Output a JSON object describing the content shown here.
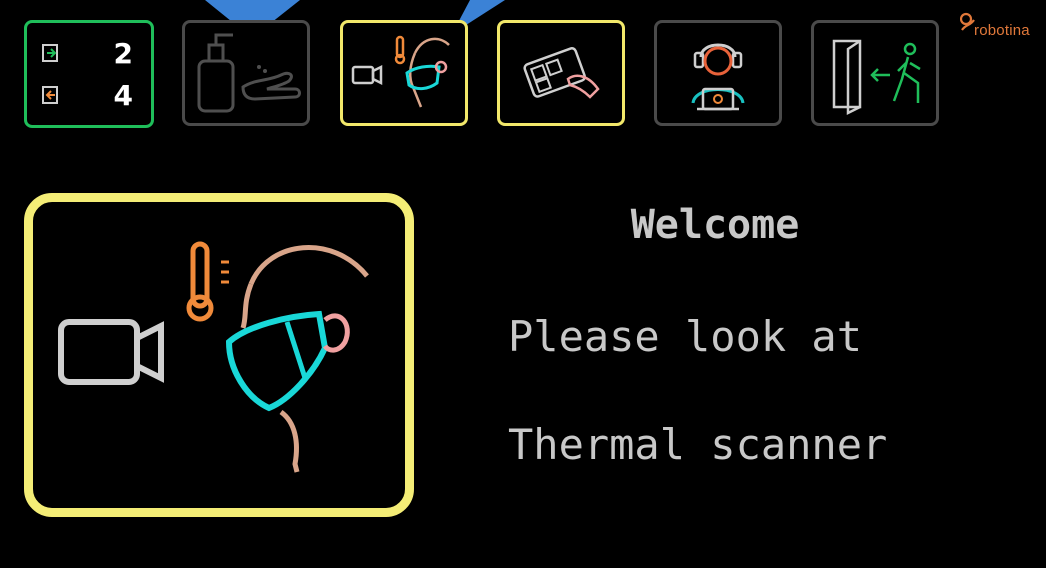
{
  "brand": {
    "name": "robotina"
  },
  "counters": {
    "entered": "2",
    "exited": "4"
  },
  "steps": [
    {
      "icon": "entry-exit-counter-icon",
      "active": false
    },
    {
      "icon": "hand-sanitizer-icon",
      "active": false
    },
    {
      "icon": "thermal-scan-icon",
      "active": true
    },
    {
      "icon": "qr-card-icon",
      "active": true
    },
    {
      "icon": "operator-headset-icon",
      "active": false
    },
    {
      "icon": "exit-door-icon",
      "active": false
    }
  ],
  "message": {
    "title": "Welcome",
    "line1": "Please look at",
    "line2": "Thermal scanner"
  },
  "colors": {
    "background": "#000000",
    "active_border": "#f2e86a",
    "inactive_border": "#4a4a4a",
    "counter_border": "#1fbe5a",
    "mask": "#19d8d8",
    "thermometer": "#f08a3a",
    "text": "#c8c8c8",
    "pointer": "#3b82d6"
  }
}
